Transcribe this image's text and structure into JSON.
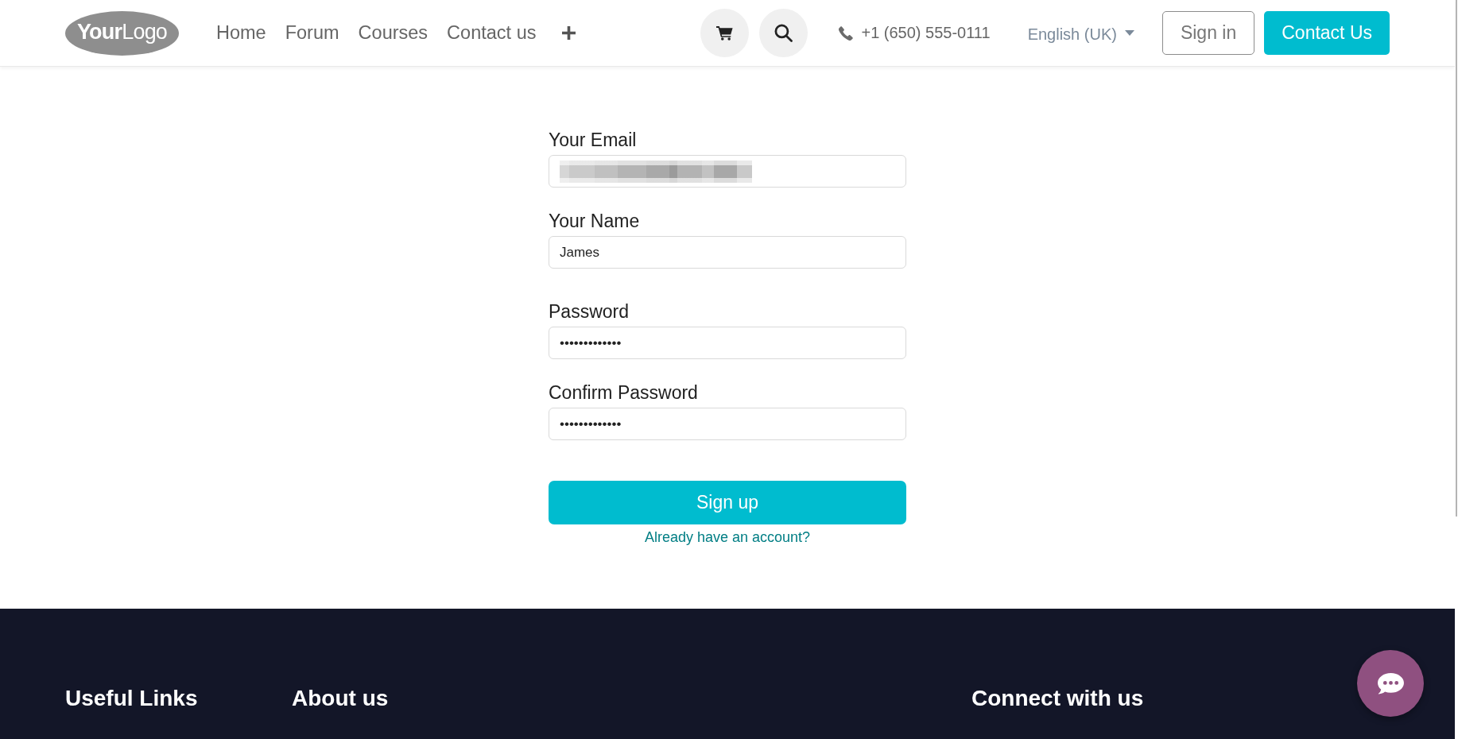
{
  "header": {
    "logo": "**Your**Logo",
    "nav": [
      "Home",
      "Forum",
      "Courses",
      "Contact us"
    ],
    "phone": "+1 (650) 555-0111",
    "language": "English (UK)",
    "buttons": [
      {
        "label": "Sign in",
        "kind": "outline"
      },
      {
        "label": "Contact Us",
        "kind": "primary"
      }
    ]
  },
  "form": {
    "fields": [
      {
        "label": "Your Email",
        "kind": "redacted"
      },
      {
        "label": "Your Name",
        "kind": "text",
        "value": "James"
      },
      {
        "label": "Password",
        "kind": "password",
        "value": "•••••••••••••"
      },
      {
        "label": "Confirm Password",
        "kind": "password",
        "value": "•••••••••••••"
      }
    ],
    "submit": "Sign up",
    "link": "Already have an account?"
  },
  "footer": {
    "headings": [
      "Useful Links",
      "About us",
      "Connect with us"
    ]
  }
}
